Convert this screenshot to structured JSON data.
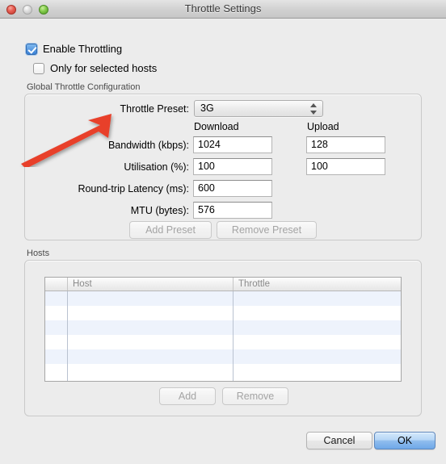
{
  "window": {
    "title": "Throttle Settings",
    "controls": {
      "close": "close-button",
      "minimize": "minimize-button",
      "zoom": "zoom-button"
    }
  },
  "options": {
    "enable_throttling": {
      "label": "Enable Throttling",
      "checked": true
    },
    "only_selected_hosts": {
      "label": "Only for selected hosts",
      "checked": false
    }
  },
  "global_config": {
    "group_title": "Global Throttle Configuration",
    "preset": {
      "label": "Throttle Preset:",
      "value": "3G"
    },
    "column_headers": {
      "download": "Download",
      "upload": "Upload"
    },
    "rows": [
      {
        "label": "Bandwidth (kbps):",
        "download": "1024",
        "upload": "128"
      },
      {
        "label": "Utilisation (%):",
        "download": "100",
        "upload": "100"
      },
      {
        "label": "Round-trip Latency (ms):",
        "download": "600",
        "upload": ""
      },
      {
        "label": "MTU (bytes):",
        "download": "576",
        "upload": ""
      }
    ],
    "buttons": {
      "add_preset": "Add Preset",
      "remove_preset": "Remove Preset"
    }
  },
  "hosts": {
    "group_title": "Hosts",
    "columns": [
      "",
      "Host",
      "Throttle"
    ],
    "rows": [],
    "buttons": {
      "add": "Add",
      "remove": "Remove"
    }
  },
  "footer": {
    "cancel": "Cancel",
    "ok": "OK"
  },
  "annotation": {
    "arrow": "red-arrow-pointing-to-throttle-preset",
    "color": "#e8402a"
  }
}
